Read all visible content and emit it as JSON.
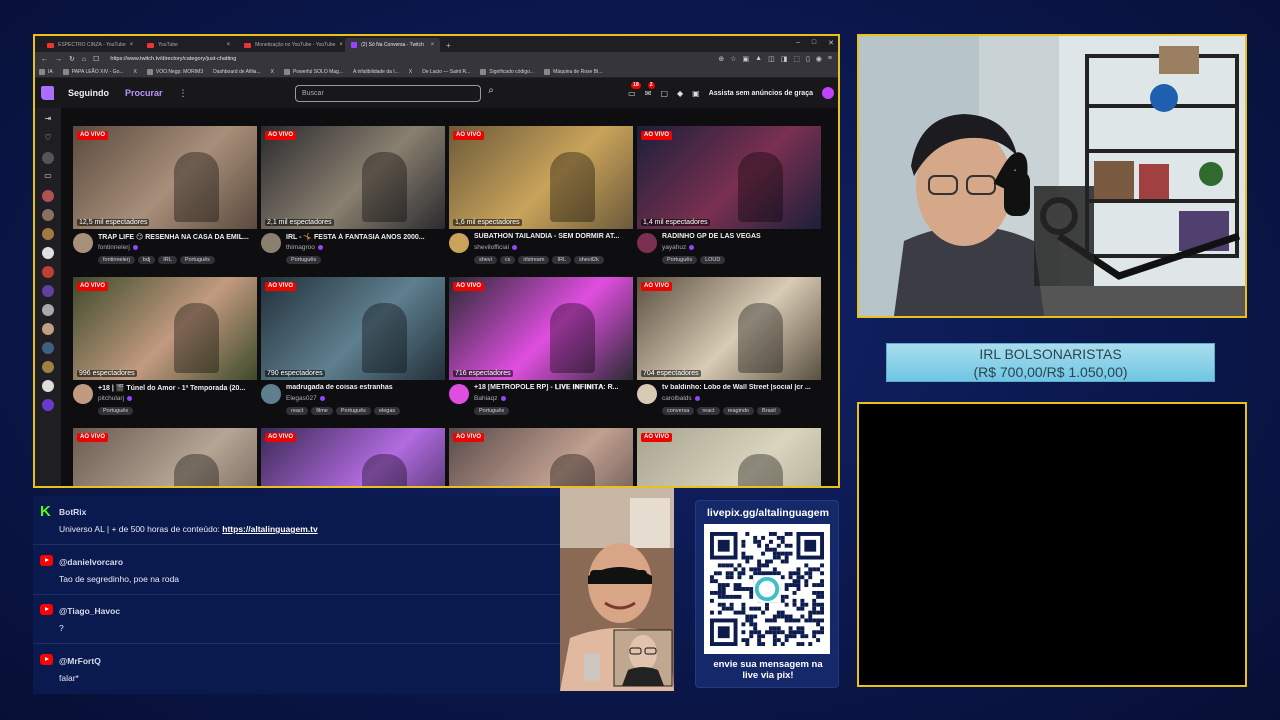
{
  "browser": {
    "tabs": [
      {
        "title": "ESPECTRO CINZA - YouTube",
        "icon": "youtube-icon",
        "active": false
      },
      {
        "title": "YouTube",
        "icon": "youtube-icon",
        "active": false
      },
      {
        "title": "Monetização no YouTube - YouTube",
        "icon": "youtube-icon",
        "active": false
      },
      {
        "title": "(2) Só Na Conversa - Twitch",
        "icon": "twitch-icon",
        "active": true
      }
    ],
    "url": "https://www.twitch.tv/directory/category/just-chatting",
    "bookmarks": [
      "IA",
      "PAPA LEÃO XIV - Go...",
      "X",
      "VOO.Negp: MORIM3",
      "Dashboard de Afilia...",
      "X",
      "Powerful SOLO Mag...",
      "A infalibilidade da I...",
      "X",
      "De Lacio — Saint R...",
      "Significado código...",
      "Máquina de Rose Bl..."
    ]
  },
  "twitch": {
    "nav_following": "Seguindo",
    "nav_browse": "Procurar",
    "search_placeholder": "Buscar",
    "notif_count": "18",
    "inbox_count": "2",
    "turbo": "Assista sem anúncios de graça",
    "live_label": "AO VIVO"
  },
  "streams": [
    {
      "title": "TRAP LIFE 😏 RESENHA NA CASA DA EMIL...",
      "channel": "fontinnelerj",
      "viewers": "12,5 mil espectadores",
      "tags": [
        "fontinnelerj",
        "bdj",
        "IRL",
        "Português"
      ],
      "color": "#5a4a3e",
      "accent": "#a88f7a"
    },
    {
      "title": "IRL - 🤸 FESTA À FANTASIA ANOS 2000...",
      "channel": "thimagroo",
      "viewers": "2,1 mil espectadores",
      "tags": [
        "Português"
      ],
      "color": "#2a2a2e",
      "accent": "#8a8070"
    },
    {
      "title": "SUBATHON TAILANDIA - SEM DORMIR AT...",
      "channel": "shevilofficial",
      "viewers": "1,6 mil espectadores",
      "tags": [
        "shevi",
        "cs",
        "irlstream",
        "IRL",
        "shevil2k"
      ],
      "color": "#6b5a3a",
      "accent": "#c9a35a"
    },
    {
      "title": "RADINHO GP DE LAS VEGAS",
      "channel": "yayahuz",
      "viewers": "1,4 mil espectadores",
      "tags": [
        "Português",
        "LOUD"
      ],
      "color": "#1b1f3a",
      "accent": "#7a3050"
    },
    {
      "title": "+18 | 🎬 Túnel do Amor - 1ª Temporada (20...",
      "channel": "pitchularj",
      "viewers": "996 espectadores",
      "tags": [
        "Português"
      ],
      "color": "#3d4a2a",
      "accent": "#c29a80"
    },
    {
      "title": "madrugada de coisas estranhas",
      "channel": "Elegas027",
      "viewers": "790 espectadores",
      "tags": [
        "react",
        "filme",
        "Português",
        "elegas"
      ],
      "color": "#22303a",
      "accent": "#5f7f8f"
    },
    {
      "title": "+18 [METRÓPOLE RP] - 𝐋𝐈𝐕𝐄 𝐈𝐍𝐅𝐈𝐍𝐈𝐓𝐀: R...",
      "channel": "Bahiaqz",
      "viewers": "716 espectadores",
      "tags": [
        "Português"
      ],
      "color": "#2a2a33",
      "accent": "#e04ee0"
    },
    {
      "title": "tv baldinho: Lobo de Wall Street |social |cr ...",
      "channel": "carolbalds",
      "viewers": "704 espectadores",
      "tags": [
        "conversa",
        "react",
        "reagindo",
        "Brasil"
      ],
      "color": "#5a5040",
      "accent": "#d8cbb5"
    },
    {
      "title": "",
      "channel": "",
      "viewers": "",
      "tags": [],
      "color": "#6a5a50",
      "accent": "#b5a595"
    },
    {
      "title": "",
      "channel": "",
      "viewers": "",
      "tags": [],
      "color": "#3a2a55",
      "accent": "#b26be0"
    },
    {
      "title": "",
      "channel": "",
      "viewers": "",
      "tags": [],
      "color": "#5a4a4a",
      "accent": "#c0a090"
    },
    {
      "title": "",
      "channel": "",
      "viewers": "",
      "tags": [],
      "color": "#a8a38f",
      "accent": "#d9d4bd"
    }
  ],
  "goal": {
    "line1": "IRL BOLSONARISTAS",
    "line2": "(R$ 700,00/R$ 1.050,00)",
    "progress": 0.667
  },
  "chat": [
    {
      "platform": "kick",
      "user": "BotRix",
      "text": "Universo AL | + de 500 horas de conteúdo: ",
      "link": "https://altalinguagem.tv"
    },
    {
      "platform": "youtube",
      "user": "@danielvorcaro",
      "text": "Tao de segredinho, poe na roda",
      "link": ""
    },
    {
      "platform": "youtube",
      "user": "@Tiago_Havoc",
      "text": "?",
      "link": ""
    },
    {
      "platform": "youtube",
      "user": "@MrFortQ",
      "text": "falar*",
      "link": ""
    }
  ],
  "qr": {
    "title": "livepix.gg/altalinguagem",
    "caption_line1": "envie sua mensagem na",
    "caption_line2": "live via pix!"
  },
  "colors": {
    "frame": "#e9c11a",
    "twitch_purple": "#9147ff",
    "live_red": "#eb0400",
    "goal": "#8fd3ea",
    "background": "#0c1a52"
  }
}
